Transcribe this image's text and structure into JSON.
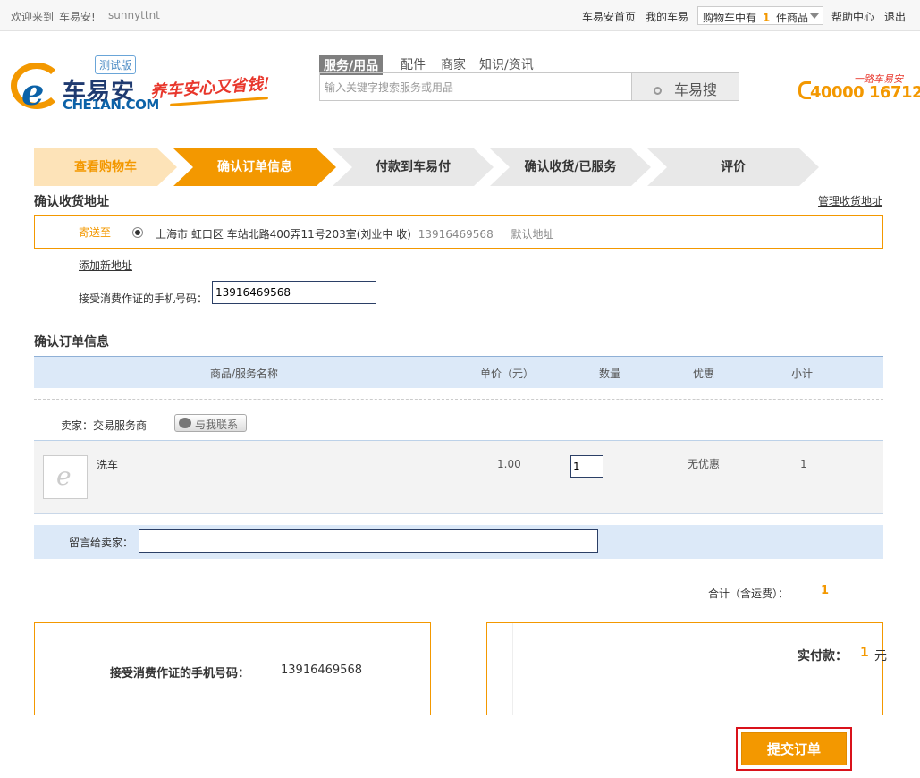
{
  "topbar": {
    "welcome": "欢迎来到",
    "site_name": "车易安!",
    "username": "sunnyttnt",
    "links": [
      "车易安首页",
      "我的车易"
    ],
    "cart_prefix": "购物车中有",
    "cart_count": "1",
    "cart_suffix": "件商品",
    "help": "帮助中心",
    "logout": "退出"
  },
  "header": {
    "logo_cn": "车易安",
    "logo_en": "CHE1AN.COM",
    "beta_badge": "测试版",
    "slogan": "养车安心又省钱!",
    "search_tabs": [
      "服务/用品",
      "配件",
      "商家",
      "知识/资讯"
    ],
    "search_placeholder": "输入关键字搜索服务或用品",
    "search_button": "车易搜",
    "phone_slogan": "一路车易安",
    "phone": "40000 16712"
  },
  "steps": [
    "查看购物车",
    "确认订单信息",
    "付款到车易付",
    "确认收货/已服务",
    "评价"
  ],
  "address": {
    "title": "确认收货地址",
    "manage_link": "管理收货地址",
    "send_to": "寄送至",
    "address_text": "上海市  虹口区  车站北路400弄11号203室(刘业中  收)",
    "phone": "13916469568",
    "default_tag": "默认地址",
    "add_link": "添加新地址",
    "mobile_label": "接受消费作证的手机号码：",
    "mobile_value": "13916469568"
  },
  "order": {
    "title": "确认订单信息",
    "headers": [
      "商品/服务名称",
      "单价（元）",
      "数量",
      "优惠",
      "小计"
    ],
    "seller_label": "卖家：交易服务商",
    "contact_button": "与我联系",
    "item": {
      "name": "洗车",
      "price": "1.00",
      "quantity": "1",
      "discount": "无优惠",
      "subtotal": "1"
    },
    "message_label": "留言给卖家：",
    "message_value": "",
    "total_label": "合计（含运费）：",
    "total_value": "1"
  },
  "summary": {
    "mobile_label": "接受消费作证的手机号码：",
    "mobile_value": "13916469568",
    "pay_label": "实付款：",
    "pay_value": "1",
    "pay_unit": "元",
    "submit_button": "提交订单"
  },
  "colors": {
    "accent": "#f39800",
    "step_active": "#f39800",
    "step_done": "#fde3b8",
    "step_todo": "#e8e8e8",
    "table_header": "#dce9f8",
    "submit_border": "#d9121b"
  }
}
